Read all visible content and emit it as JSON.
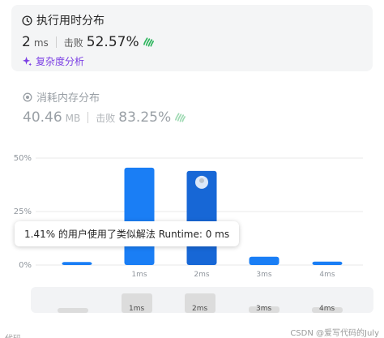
{
  "runtime": {
    "title": "执行用时分布",
    "value": "2",
    "unit": "ms",
    "beats_label": "击败",
    "beats_percent": "52.57%",
    "analysis_link": "复杂度分析"
  },
  "memory": {
    "title": "消耗内存分布",
    "value": "40.46",
    "unit": "MB",
    "beats_label": "击败",
    "beats_percent": "83.25%"
  },
  "tooltip": "1.41% 的用户使用了类似解法 Runtime: 0 ms",
  "chart_data": {
    "type": "bar",
    "categories": [
      "0ms",
      "1ms",
      "2ms",
      "3ms",
      "4ms"
    ],
    "x_tick_labels": [
      "1ms",
      "2ms",
      "3ms",
      "4ms"
    ],
    "values": [
      1.41,
      45.5,
      44.0,
      3.9,
      1.6
    ],
    "y_ticks": [
      "50%",
      "25%",
      "0%"
    ],
    "ylim": [
      0,
      50
    ],
    "highlight_index": 2,
    "colors": {
      "bar": "#1a7ef5",
      "highlight": "#1767d6"
    }
  },
  "overview": {
    "labels": [
      "1ms",
      "2ms",
      "3ms",
      "4ms"
    ]
  },
  "footer": {
    "left": "代码",
    "watermark": "CSDN @爱写代码的July"
  }
}
